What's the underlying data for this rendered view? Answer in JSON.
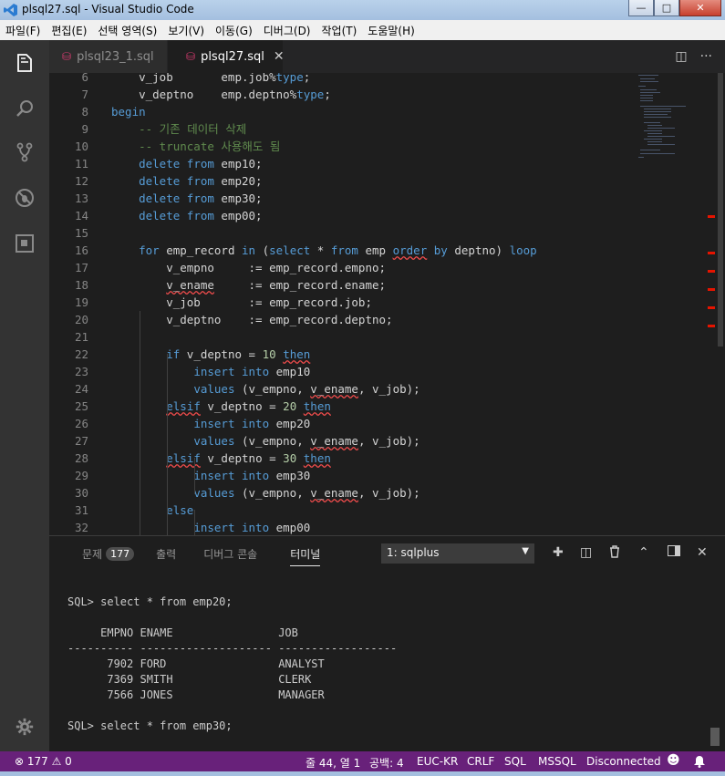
{
  "window": {
    "title": "plsql27.sql - Visual Studio Code"
  },
  "menu": [
    "파일(F)",
    "편집(E)",
    "선택 영역(S)",
    "보기(V)",
    "이동(G)",
    "디버그(D)",
    "작업(T)",
    "도움말(H)"
  ],
  "tabs": [
    {
      "label": "plsql23_1.sql",
      "active": false
    },
    {
      "label": "plsql27.sql",
      "active": true
    }
  ],
  "editor": {
    "lines": [
      {
        "n": "6",
        "t": "    v_job       emp.job%type;"
      },
      {
        "n": "7",
        "t": "    v_deptno    emp.deptno%type;"
      },
      {
        "n": "8",
        "t": "begin"
      },
      {
        "n": "9",
        "t": "    -- 기존 데이터 삭제"
      },
      {
        "n": "10",
        "t": "    -- truncate 사용해도 됨"
      },
      {
        "n": "11",
        "t": "    delete from emp10;"
      },
      {
        "n": "12",
        "t": "    delete from emp20;"
      },
      {
        "n": "13",
        "t": "    delete from emp30;"
      },
      {
        "n": "14",
        "t": "    delete from emp00;"
      },
      {
        "n": "15",
        "t": ""
      },
      {
        "n": "16",
        "t": "    for emp_record in (select * from emp order by deptno) loop"
      },
      {
        "n": "17",
        "t": "        v_empno     := emp_record.empno;"
      },
      {
        "n": "18",
        "t": "        v_ename     := emp_record.ename;"
      },
      {
        "n": "19",
        "t": "        v_job       := emp_record.job;"
      },
      {
        "n": "20",
        "t": "        v_deptno    := emp_record.deptno;"
      },
      {
        "n": "21",
        "t": ""
      },
      {
        "n": "22",
        "t": "        if v_deptno = 10 then"
      },
      {
        "n": "23",
        "t": "            insert into emp10"
      },
      {
        "n": "24",
        "t": "            values (v_empno, v_ename, v_job);"
      },
      {
        "n": "25",
        "t": "        elsif v_deptno = 20 then"
      },
      {
        "n": "26",
        "t": "            insert into emp20"
      },
      {
        "n": "27",
        "t": "            values (v_empno, v_ename, v_job);"
      },
      {
        "n": "28",
        "t": "        elsif v_deptno = 30 then"
      },
      {
        "n": "29",
        "t": "            insert into emp30"
      },
      {
        "n": "30",
        "t": "            values (v_empno, v_ename, v_job);"
      },
      {
        "n": "31",
        "t": "        else"
      },
      {
        "n": "32",
        "t": "            insert into emp00"
      }
    ]
  },
  "panel": {
    "tabs": {
      "problems": "문제",
      "problems_count": "177",
      "output": "출력",
      "debug_console": "디버그 콘솔",
      "terminal": "터미널"
    },
    "terminal_select": "1: sqlplus",
    "terminal_lines": [
      "SQL> select * from emp20;",
      "",
      "     EMPNO ENAME                JOB",
      "---------- -------------------- ------------------",
      "      7902 FORD                 ANALYST",
      "      7369 SMITH                CLERK",
      "      7566 JONES                MANAGER",
      "",
      "SQL> select * from emp30;"
    ]
  },
  "status": {
    "errors": "177",
    "warnings": "0",
    "position": "줄 44, 열 1",
    "spaces": "공백: 4",
    "encoding": "EUC-KR",
    "eol": "CRLF",
    "language": "SQL",
    "dialect": "MSSQL",
    "connection": "Disconnected"
  },
  "colors": {
    "statusbar": "#68217a",
    "keyword": "#569cd6",
    "comment": "#608b4e",
    "number": "#b5cea8"
  }
}
